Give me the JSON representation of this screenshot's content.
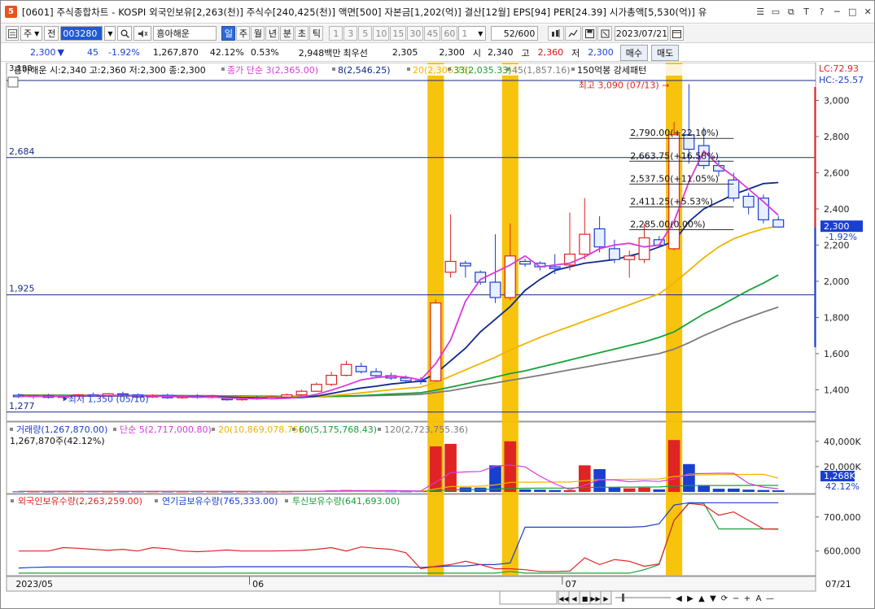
{
  "window": {
    "icon_label": "5",
    "title": "[0601] 주식종합차트 - KOSPI 외국인보유[2,263(천)] 주식수[240,425(천)] 액면[500] 자본금[1,202(억)] 결산[12월] EPS[94] PER[24.39] 시가총액[5,530(억)] 유",
    "controls": [
      "☰",
      "▭",
      "⧉",
      "T",
      "?",
      "─",
      "□",
      "✕"
    ]
  },
  "toolbar": {
    "market": "주",
    "all": "전",
    "code": "003280",
    "stock_name": "흥아해운",
    "periods": [
      {
        "label": "일",
        "active": true
      },
      {
        "label": "주",
        "active": false
      },
      {
        "label": "월",
        "active": false
      },
      {
        "label": "년",
        "active": false
      },
      {
        "label": "분",
        "active": false
      },
      {
        "label": "초",
        "active": false
      },
      {
        "label": "틱",
        "active": false
      }
    ],
    "intervals": [
      "1",
      "3",
      "5",
      "10",
      "15",
      "30",
      "45",
      "60"
    ],
    "interval_select": "1",
    "view_count": "52",
    "view_total": "/600",
    "date": "2023/07/21",
    "date_caret": "▾"
  },
  "quote": {
    "price": "2,300",
    "arrow": "▼",
    "change": "45",
    "change_pct": "-1.92%",
    "volume": "1,267,870",
    "turnover": "42.12%",
    "ratio": "0.53%",
    "amount": "2,948백만",
    "pref_label": "최우선",
    "pref_value": "2,305",
    "pref_value2": "2,300",
    "open_label": "시",
    "open": "2,340",
    "high_label": "고",
    "high": "2,360",
    "low_label": "저",
    "low": "2,300",
    "buy": "매수",
    "sell": "매도"
  },
  "colors": {
    "up": "#e02424",
    "down": "#1a3fd0",
    "ma5": "#d83ad8",
    "ma8": "#0d2a8a",
    "ma20": "#f0b400",
    "ma33": "#19a039",
    "ma45": "#7b7b7b",
    "highlight": "#f7c000",
    "hline": "#1a2a8a"
  },
  "chart_data": {
    "type": "candlestick",
    "price_legend": [
      {
        "text": "흥아해운 시:2,340 고:2,360 저:2,300 종:2,300",
        "color": "#111"
      },
      {
        "text": "종가 단순 3(2,365.00)",
        "color": "#d83ad8"
      },
      {
        "text": "8(2,546.25)",
        "color": "#0d2a8a"
      },
      {
        "text": "20(2,306.75)",
        "color": "#f0b400"
      },
      {
        "text": "33(2,035.33)",
        "color": "#19a039"
      },
      {
        "text": "45(1,857.16)",
        "color": "#7b7b7b"
      },
      {
        "text": "150억봉 강세패턴",
        "color": "#111"
      }
    ],
    "top_value": "3,198",
    "lc_label": "LC:72.93",
    "hc_label": "HC:-25.57",
    "ymin": 1240,
    "ymax": 3200,
    "y_ticks": [
      1400,
      1600,
      1800,
      2000,
      2200,
      2400,
      2600,
      2800,
      3000
    ],
    "y_tick_labels": [
      "1,400",
      "1,600",
      "1,800",
      "2,000",
      "2,200",
      "2,400",
      "2,600",
      "2,800",
      "3,000"
    ],
    "h_lines": [
      {
        "value": 2684,
        "label": "2,684"
      },
      {
        "value": 1925,
        "label": "1,925"
      },
      {
        "value": 1277,
        "label": "1,277"
      }
    ],
    "top_hline": 3110,
    "high_annotation": {
      "text": "최고 3,090 (07/13)",
      "value": 3090,
      "index": 45
    },
    "low_annotation": {
      "text": "최저 1,350 (05/10)",
      "value": 1350,
      "index": 3
    },
    "fib_levels": [
      {
        "value": 2790,
        "label": "2,790.00(+22.10%)"
      },
      {
        "value": 2663.75,
        "label": "2,663.75(+16.58%)"
      },
      {
        "value": 2537.5,
        "label": "2,537.50(+11.05%)"
      },
      {
        "value": 2411.25,
        "label": "2,411.25(+5.53%)"
      },
      {
        "value": 2285,
        "label": "2,285.00(0.00%)"
      }
    ],
    "current_price": {
      "value": 2300,
      "label": "2,300",
      "pct": "-1.92%"
    },
    "x_labels": [
      {
        "index": 0,
        "label": "2023/05"
      },
      {
        "index": 16,
        "label": "06"
      },
      {
        "index": 37,
        "label": "07"
      },
      {
        "index": 51,
        "label": "07/21"
      }
    ],
    "highlight_bars": [
      28,
      33,
      44
    ],
    "candles": [
      {
        "o": 1370,
        "h": 1380,
        "l": 1355,
        "c": 1362
      },
      {
        "o": 1362,
        "h": 1375,
        "l": 1350,
        "c": 1368
      },
      {
        "o": 1368,
        "h": 1378,
        "l": 1352,
        "c": 1358
      },
      {
        "o": 1358,
        "h": 1372,
        "l": 1350,
        "c": 1366
      },
      {
        "o": 1366,
        "h": 1378,
        "l": 1360,
        "c": 1372
      },
      {
        "o": 1372,
        "h": 1385,
        "l": 1362,
        "c": 1365
      },
      {
        "o": 1365,
        "h": 1382,
        "l": 1362,
        "c": 1378
      },
      {
        "o": 1378,
        "h": 1390,
        "l": 1368,
        "c": 1372
      },
      {
        "o": 1372,
        "h": 1380,
        "l": 1355,
        "c": 1360
      },
      {
        "o": 1360,
        "h": 1375,
        "l": 1355,
        "c": 1370
      },
      {
        "o": 1370,
        "h": 1378,
        "l": 1350,
        "c": 1356
      },
      {
        "o": 1356,
        "h": 1370,
        "l": 1350,
        "c": 1365
      },
      {
        "o": 1365,
        "h": 1376,
        "l": 1352,
        "c": 1358
      },
      {
        "o": 1358,
        "h": 1372,
        "l": 1352,
        "c": 1366
      },
      {
        "o": 1352,
        "h": 1362,
        "l": 1340,
        "c": 1345
      },
      {
        "o": 1345,
        "h": 1360,
        "l": 1340,
        "c": 1355
      },
      {
        "o": 1355,
        "h": 1365,
        "l": 1345,
        "c": 1350
      },
      {
        "o": 1350,
        "h": 1366,
        "l": 1345,
        "c": 1360
      },
      {
        "o": 1360,
        "h": 1380,
        "l": 1355,
        "c": 1372
      },
      {
        "o": 1372,
        "h": 1400,
        "l": 1368,
        "c": 1392
      },
      {
        "o": 1392,
        "h": 1440,
        "l": 1388,
        "c": 1430
      },
      {
        "o": 1430,
        "h": 1500,
        "l": 1420,
        "c": 1480
      },
      {
        "o": 1480,
        "h": 1560,
        "l": 1475,
        "c": 1540
      },
      {
        "o": 1530,
        "h": 1550,
        "l": 1490,
        "c": 1500
      },
      {
        "o": 1500,
        "h": 1520,
        "l": 1470,
        "c": 1478
      },
      {
        "o": 1478,
        "h": 1495,
        "l": 1455,
        "c": 1465
      },
      {
        "o": 1465,
        "h": 1480,
        "l": 1440,
        "c": 1450
      },
      {
        "o": 1450,
        "h": 1470,
        "l": 1430,
        "c": 1445
      },
      {
        "o": 1450,
        "h": 1900,
        "l": 1445,
        "c": 1880
      },
      {
        "o": 2050,
        "h": 2370,
        "l": 2020,
        "c": 2110
      },
      {
        "o": 2100,
        "h": 2115,
        "l": 2020,
        "c": 2085
      },
      {
        "o": 2050,
        "h": 2060,
        "l": 1980,
        "c": 1995
      },
      {
        "o": 1995,
        "h": 2260,
        "l": 1880,
        "c": 1910
      },
      {
        "o": 1910,
        "h": 2320,
        "l": 1895,
        "c": 2140
      },
      {
        "o": 2110,
        "h": 2125,
        "l": 2080,
        "c": 2095
      },
      {
        "o": 2100,
        "h": 2110,
        "l": 2060,
        "c": 2080
      },
      {
        "o": 2080,
        "h": 2150,
        "l": 2040,
        "c": 2070
      },
      {
        "o": 2090,
        "h": 2380,
        "l": 2060,
        "c": 2150
      },
      {
        "o": 2150,
        "h": 2460,
        "l": 2120,
        "c": 2260
      },
      {
        "o": 2290,
        "h": 2360,
        "l": 2160,
        "c": 2190
      },
      {
        "o": 2180,
        "h": 2230,
        "l": 2100,
        "c": 2120
      },
      {
        "o": 2120,
        "h": 2170,
        "l": 2020,
        "c": 2140
      },
      {
        "o": 2120,
        "h": 2320,
        "l": 2100,
        "c": 2240
      },
      {
        "o": 2230,
        "h": 2250,
        "l": 2190,
        "c": 2200
      },
      {
        "o": 2180,
        "h": 2880,
        "l": 2170,
        "c": 2810
      },
      {
        "o": 2810,
        "h": 3090,
        "l": 2650,
        "c": 2730
      },
      {
        "o": 2750,
        "h": 2850,
        "l": 2620,
        "c": 2640
      },
      {
        "o": 2640,
        "h": 2670,
        "l": 2580,
        "c": 2610
      },
      {
        "o": 2560,
        "h": 2600,
        "l": 2440,
        "c": 2460
      },
      {
        "o": 2470,
        "h": 2490,
        "l": 2370,
        "c": 2410
      },
      {
        "o": 2460,
        "h": 2480,
        "l": 2320,
        "c": 2340
      },
      {
        "o": 2340,
        "h": 2360,
        "l": 2300,
        "c": 2300
      }
    ],
    "ma5": [
      1365,
      1364,
      1364,
      1365,
      1366,
      1368,
      1368,
      1368,
      1367,
      1365,
      1363,
      1361,
      1360,
      1360,
      1355,
      1352,
      1352,
      1352,
      1353,
      1360,
      1375,
      1398,
      1425,
      1455,
      1468,
      1475,
      1470,
      1455,
      1545,
      1675,
      1890,
      2010,
      2050,
      2090,
      2140,
      2080,
      2090,
      2100,
      2135,
      2180,
      2200,
      2210,
      2190,
      2200,
      2330,
      2550,
      2720,
      2640,
      2580,
      2510,
      2440,
      2365
    ],
    "ma8": [
      1365,
      1365,
      1364,
      1364,
      1365,
      1366,
      1366,
      1367,
      1367,
      1366,
      1365,
      1364,
      1363,
      1362,
      1360,
      1358,
      1356,
      1355,
      1355,
      1357,
      1365,
      1380,
      1395,
      1410,
      1420,
      1432,
      1440,
      1448,
      1490,
      1560,
      1630,
      1720,
      1790,
      1860,
      1950,
      2010,
      2060,
      2080,
      2100,
      2110,
      2120,
      2140,
      2160,
      2190,
      2220,
      2330,
      2400,
      2440,
      2480,
      2510,
      2540,
      2546
    ],
    "ma20": [
      1368,
      1367,
      1367,
      1366,
      1366,
      1366,
      1366,
      1366,
      1366,
      1366,
      1366,
      1365,
      1365,
      1364,
      1363,
      1362,
      1361,
      1360,
      1360,
      1361,
      1363,
      1368,
      1375,
      1383,
      1392,
      1400,
      1408,
      1415,
      1440,
      1475,
      1510,
      1545,
      1580,
      1620,
      1655,
      1690,
      1720,
      1750,
      1780,
      1810,
      1840,
      1870,
      1900,
      1930,
      1990,
      2060,
      2130,
      2190,
      2235,
      2265,
      2290,
      2306
    ],
    "ma33": [
      1370,
      1370,
      1369,
      1369,
      1368,
      1368,
      1368,
      1367,
      1367,
      1367,
      1367,
      1366,
      1366,
      1365,
      1365,
      1364,
      1363,
      1362,
      1362,
      1362,
      1362,
      1363,
      1365,
      1368,
      1372,
      1376,
      1380,
      1384,
      1398,
      1415,
      1432,
      1450,
      1470,
      1490,
      1505,
      1525,
      1545,
      1565,
      1585,
      1605,
      1625,
      1645,
      1665,
      1690,
      1720,
      1770,
      1820,
      1860,
      1905,
      1950,
      1990,
      2035
    ],
    "ma45": [
      1372,
      1371,
      1371,
      1370,
      1370,
      1370,
      1369,
      1369,
      1369,
      1368,
      1368,
      1368,
      1367,
      1367,
      1366,
      1366,
      1365,
      1365,
      1364,
      1364,
      1364,
      1364,
      1365,
      1366,
      1368,
      1370,
      1372,
      1375,
      1385,
      1395,
      1410,
      1425,
      1438,
      1452,
      1466,
      1480,
      1495,
      1510,
      1525,
      1540,
      1555,
      1570,
      1585,
      1600,
      1625,
      1660,
      1700,
      1735,
      1770,
      1800,
      1830,
      1857
    ],
    "volume_legend": [
      {
        "text": "거래량(1,267,870.00)",
        "color": "#1a3fd0"
      },
      {
        "text": "단순 5(2,717,000.80)",
        "color": "#d83ad8"
      },
      {
        "text": "20(10,869,078.75)",
        "color": "#f0b400"
      },
      {
        "text": "60(5,175,768.43)",
        "color": "#19a039"
      },
      {
        "text": "120(2,723,755.36)",
        "color": "#7b7b7b"
      }
    ],
    "volume_sub": "1,267,870주(42.12%)",
    "volume_ymax": 45000,
    "volume_ticks": [
      20000,
      40000
    ],
    "volume_tick_labels": [
      "20,000K",
      "40,000K"
    ],
    "volume_last_label": "1,268K",
    "volume_last_pct": "42.12%",
    "volume": [
      420,
      380,
      350,
      400,
      420,
      450,
      380,
      360,
      400,
      420,
      380,
      350,
      400,
      380,
      300,
      350,
      320,
      300,
      400,
      600,
      900,
      1200,
      1500,
      800,
      600,
      500,
      450,
      600,
      36000,
      38000,
      3600,
      3400,
      21000,
      40000,
      2000,
      1800,
      1500,
      1400,
      21000,
      18000,
      3500,
      2800,
      3400,
      2000,
      41000,
      22000,
      5500,
      2500,
      2600,
      1800,
      1500,
      1268
    ],
    "vol_ma5": [
      400,
      395,
      390,
      395,
      405,
      410,
      400,
      392,
      400,
      405,
      400,
      392,
      390,
      385,
      370,
      362,
      344,
      330,
      334,
      374,
      494,
      684,
      920,
      1080,
      1100,
      1040,
      900,
      790,
      7730,
      15200,
      15800,
      16200,
      20400,
      21200,
      19800,
      12400,
      6400,
      1760,
      5320,
      9620,
      9420,
      8060,
      8780,
      8260,
      10240,
      14380,
      14580,
      14760,
      14720,
      6780,
      3800,
      2500
    ],
    "vol_ma20": [
      400,
      400,
      400,
      400,
      400,
      400,
      400,
      400,
      400,
      400,
      400,
      400,
      400,
      400,
      390,
      390,
      385,
      380,
      380,
      390,
      410,
      440,
      480,
      510,
      520,
      530,
      535,
      545,
      2330,
      4220,
      4380,
      4540,
      5560,
      7540,
      7620,
      7690,
      7750,
      7810,
      8840,
      9710,
      9850,
      9960,
      10120,
      10200,
      12220,
      13290,
      13550,
      13670,
      13780,
      13830,
      13870,
      10869
    ],
    "vol_ma60": [
      400,
      400,
      400,
      400,
      400,
      400,
      400,
      400,
      400,
      400,
      400,
      400,
      400,
      400,
      400,
      400,
      400,
      400,
      400,
      400,
      410,
      430,
      450,
      470,
      480,
      490,
      500,
      510,
      1100,
      1700,
      1780,
      1850,
      2200,
      2850,
      2900,
      2950,
      3000,
      3050,
      3400,
      3700,
      3760,
      3800,
      3870,
      3900,
      4600,
      5000,
      5050,
      5080,
      5100,
      5120,
      5150,
      5175
    ],
    "holdings_legend": [
      {
        "text": "외국인보유수량(2,263,259.00)",
        "color": "#e02424"
      },
      {
        "text": "연기금보유수량(765,333.00)",
        "color": "#1a3fd0"
      },
      {
        "text": "투신보유수량(641,693.00)",
        "color": "#19a039"
      }
    ],
    "holdings_ticks": [
      600000,
      700000
    ],
    "holdings_tick_labels": [
      "600,000",
      "700,000"
    ],
    "holdings_ymin": 530000,
    "holdings_ymax": 745000,
    "foreign": [
      600000,
      600000,
      600000,
      610000,
      608000,
      605000,
      602000,
      605000,
      600000,
      610000,
      607000,
      600000,
      598000,
      600000,
      603000,
      600000,
      600000,
      600000,
      601000,
      602000,
      605000,
      610000,
      600000,
      612000,
      608000,
      605000,
      595000,
      548000,
      555000,
      560000,
      570000,
      560000,
      548000,
      548000,
      545000,
      540000,
      540000,
      541000,
      580000,
      560000,
      575000,
      570000,
      555000,
      562000,
      690000,
      740000,
      735000,
      705000,
      715000,
      690000,
      665000,
      664000
    ],
    "pension": [
      550000,
      552000,
      553000,
      553000,
      553000,
      553000,
      553000,
      553000,
      553000,
      553000,
      553000,
      553000,
      553000,
      553000,
      554000,
      554000,
      554000,
      554000,
      554000,
      554000,
      554000,
      554000,
      554000,
      554000,
      554000,
      554000,
      554000,
      552000,
      554000,
      556000,
      556000,
      560000,
      560000,
      565000,
      670000,
      670000,
      670000,
      670000,
      670000,
      670000,
      670000,
      670000,
      672000,
      680000,
      735000,
      742000,
      742000,
      742000,
      742000,
      742000,
      742000,
      742000
    ],
    "trust": [
      535000,
      535000,
      535000,
      535000,
      535000,
      535000,
      535000,
      535000,
      535000,
      535000,
      535000,
      535000,
      535000,
      535000,
      535000,
      535000,
      535000,
      535000,
      535000,
      535000,
      535000,
      535000,
      535000,
      535000,
      535000,
      535000,
      535000,
      535000,
      535000,
      535000,
      535000,
      535000,
      535000,
      540000,
      535000,
      535000,
      535000,
      535000,
      535000,
      535000,
      535000,
      535000,
      545000,
      560000,
      690000,
      742000,
      740000,
      665000,
      665000,
      665000,
      665000,
      665000
    ]
  }
}
